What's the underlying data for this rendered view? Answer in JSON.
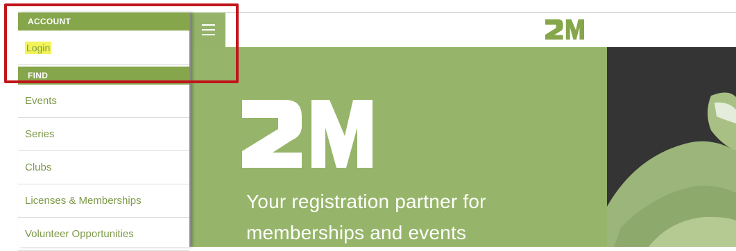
{
  "header": {
    "logo_text": "2M",
    "menu_icon": "hamburger-icon"
  },
  "sidebar": {
    "account_header": "ACCOUNT",
    "login_label": "Login",
    "find_header": "FIND",
    "items": [
      {
        "label": "Events"
      },
      {
        "label": "Series"
      },
      {
        "label": "Clubs"
      },
      {
        "label": "Licenses & Memberships"
      },
      {
        "label": "Volunteer Opportunities"
      }
    ]
  },
  "hero": {
    "logo_text": "2M",
    "tagline_line1": "Your registration partner for",
    "tagline_line2": "memberships and events"
  },
  "colors": {
    "brand_green": "#86a64b",
    "hero_green": "#96b56a",
    "link_green": "#7d9a48",
    "annotation_red": "#c0161b",
    "highlight_yellow": "#f3f35a"
  }
}
